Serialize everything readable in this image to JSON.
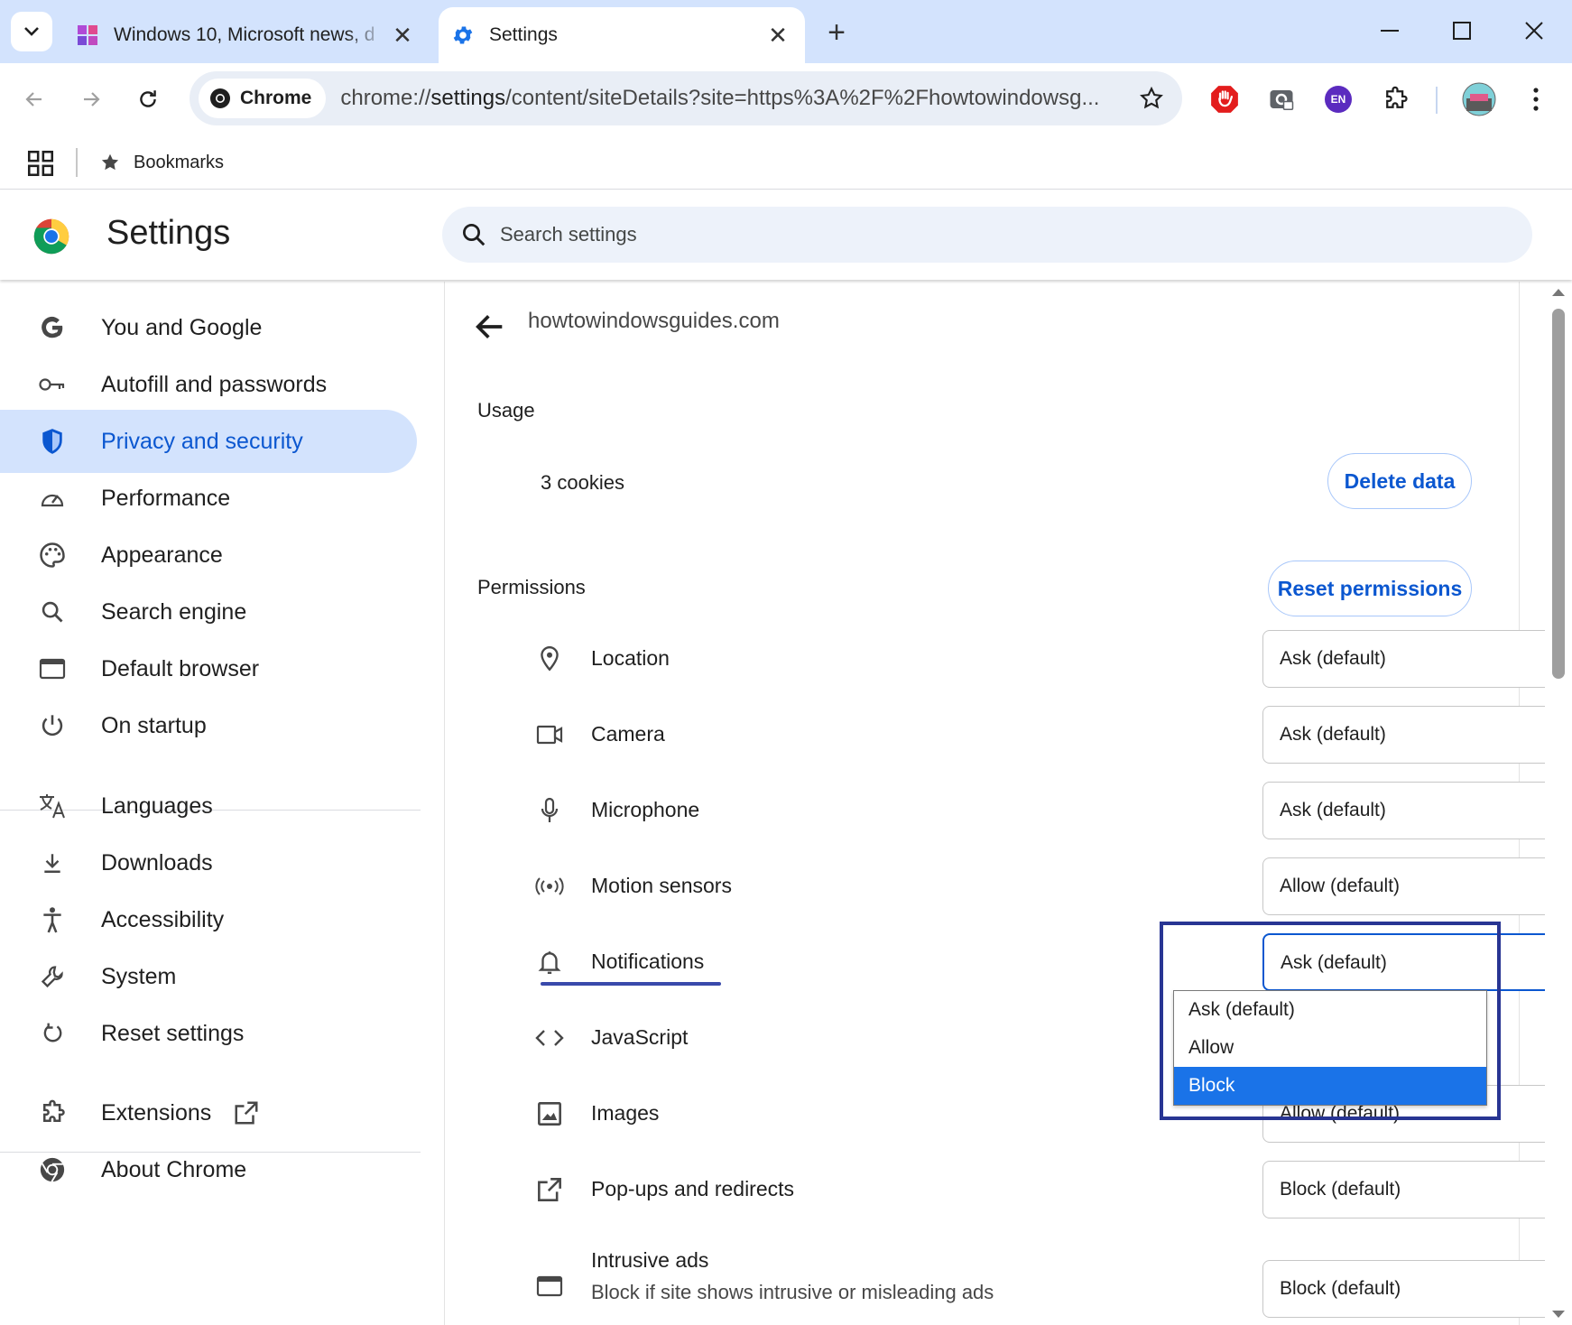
{
  "browser": {
    "tabs": [
      {
        "title": "Windows 10, Microsoft news, d",
        "active": false
      },
      {
        "title": "Settings",
        "active": true
      }
    ],
    "omnibox": {
      "chip_label": "Chrome",
      "url_prefix": "chrome://",
      "url_host": "settings",
      "url_path": "/content/siteDetails?site=https%3A%2F%2Fhowtowindowsg..."
    },
    "extensions": {
      "translate_badge": "EN"
    },
    "bookmarks": {
      "item_label": "Bookmarks"
    }
  },
  "settings": {
    "title": "Settings",
    "search_placeholder": "Search settings",
    "nav": [
      {
        "label": "You and Google",
        "icon": "google-g-icon"
      },
      {
        "label": "Autofill and passwords",
        "icon": "key-icon"
      },
      {
        "label": "Privacy and security",
        "icon": "shield-icon",
        "selected": true
      },
      {
        "label": "Performance",
        "icon": "speedometer-icon"
      },
      {
        "label": "Appearance",
        "icon": "palette-icon"
      },
      {
        "label": "Search engine",
        "icon": "search-icon"
      },
      {
        "label": "Default browser",
        "icon": "browser-window-icon"
      },
      {
        "label": "On startup",
        "icon": "power-icon"
      },
      {
        "label": "Languages",
        "icon": "translate-icon"
      },
      {
        "label": "Downloads",
        "icon": "download-icon"
      },
      {
        "label": "Accessibility",
        "icon": "accessibility-icon"
      },
      {
        "label": "System",
        "icon": "wrench-icon"
      },
      {
        "label": "Reset settings",
        "icon": "reset-icon"
      },
      {
        "label": "Extensions",
        "icon": "puzzle-icon"
      },
      {
        "label": "About Chrome",
        "icon": "chrome-icon"
      }
    ]
  },
  "site": {
    "name": "howtowindowsguides.com",
    "usage_label": "Usage",
    "cookies": "3 cookies",
    "delete_button": "Delete data",
    "permissions_label": "Permissions",
    "reset_button": "Reset permissions",
    "permissions": [
      {
        "label": "Location",
        "value": "Ask (default)",
        "icon": "location-pin-icon"
      },
      {
        "label": "Camera",
        "value": "Ask (default)",
        "icon": "camera-icon"
      },
      {
        "label": "Microphone",
        "value": "Ask (default)",
        "icon": "microphone-icon"
      },
      {
        "label": "Motion sensors",
        "value": "Allow (default)",
        "icon": "motion-sensor-icon"
      },
      {
        "label": "Notifications",
        "value": "Ask (default)",
        "icon": "bell-icon"
      },
      {
        "label": "JavaScript",
        "value": "",
        "icon": "code-brackets-icon"
      },
      {
        "label": "Images",
        "value": "Allow (default)",
        "icon": "image-icon"
      },
      {
        "label": "Pop-ups and redirects",
        "value": "Block (default)",
        "icon": "external-link-icon"
      },
      {
        "label": "Intrusive ads",
        "sublabel": "Block if site shows intrusive or misleading ads",
        "value": "Block (default)",
        "icon": "ad-window-icon"
      }
    ],
    "notification_options": [
      "Ask (default)",
      "Allow",
      "Block"
    ],
    "highlighted_option": "Block"
  },
  "colors": {
    "accent": "#0b57d0",
    "selected_nav_bg": "#d3e3fd",
    "highlight_frame": "#283593",
    "option_selected": "#1a73e8"
  }
}
